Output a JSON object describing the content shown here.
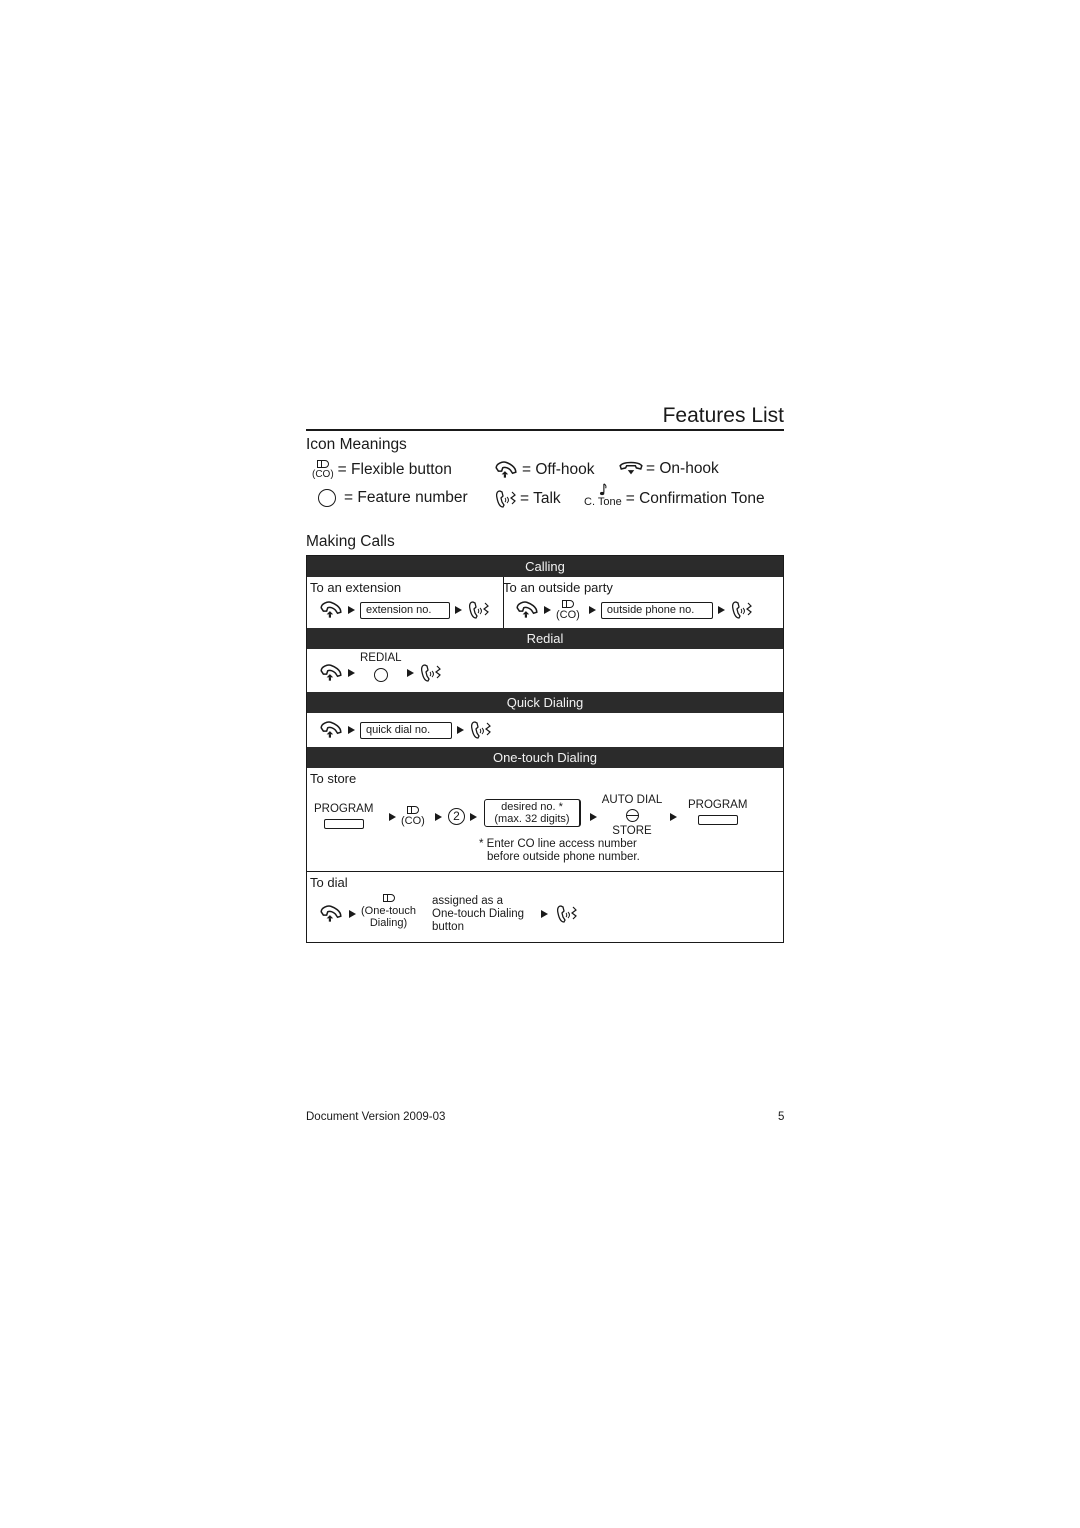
{
  "page": {
    "title": "Features List",
    "footer_left": "Document Version 2009-03",
    "page_number": "5"
  },
  "icon_meanings": {
    "heading": "Icon Meanings",
    "items": [
      {
        "icon": "flexible-button-icon",
        "icon_caption": "(CO)",
        "label": "= Flexible button"
      },
      {
        "icon": "off-hook-icon",
        "label": "= Off-hook"
      },
      {
        "icon": "on-hook-icon",
        "label": "= On-hook"
      },
      {
        "icon": "feature-number-icon",
        "label": "= Feature number"
      },
      {
        "icon": "talk-icon",
        "label": "= Talk"
      },
      {
        "icon": "confirmation-tone-icon",
        "icon_caption": "C. Tone",
        "label": "= Confirmation Tone"
      }
    ]
  },
  "making_calls": {
    "heading": "Making Calls",
    "calling": {
      "band": "Calling",
      "extension": {
        "label": "To an extension",
        "box": "extension no."
      },
      "outside": {
        "label": "To an outside party",
        "co": "(CO)",
        "box": "outside phone no."
      }
    },
    "redial": {
      "band": "Redial",
      "button_label": "REDIAL"
    },
    "quick_dialing": {
      "band": "Quick Dialing",
      "box": "quick dial no."
    },
    "one_touch": {
      "band": "One-touch Dialing",
      "store": {
        "label": "To store",
        "program_label": "PROGRAM",
        "co": "(CO)",
        "digit": "2",
        "box_line1": "desired no. *",
        "box_line2": "(max. 32 digits)",
        "auto_dial_top": "AUTO DIAL",
        "auto_dial_bottom": "STORE",
        "program_label_2": "PROGRAM",
        "note_line1": "* Enter CO line access number",
        "note_line2": "before outside phone number."
      },
      "dial": {
        "label": "To dial",
        "button_caption_1": "(One-touch",
        "button_caption_2": "Dialing)",
        "desc_line1": "assigned as a",
        "desc_line2": "One-touch Dialing",
        "desc_line3": "button"
      }
    }
  }
}
